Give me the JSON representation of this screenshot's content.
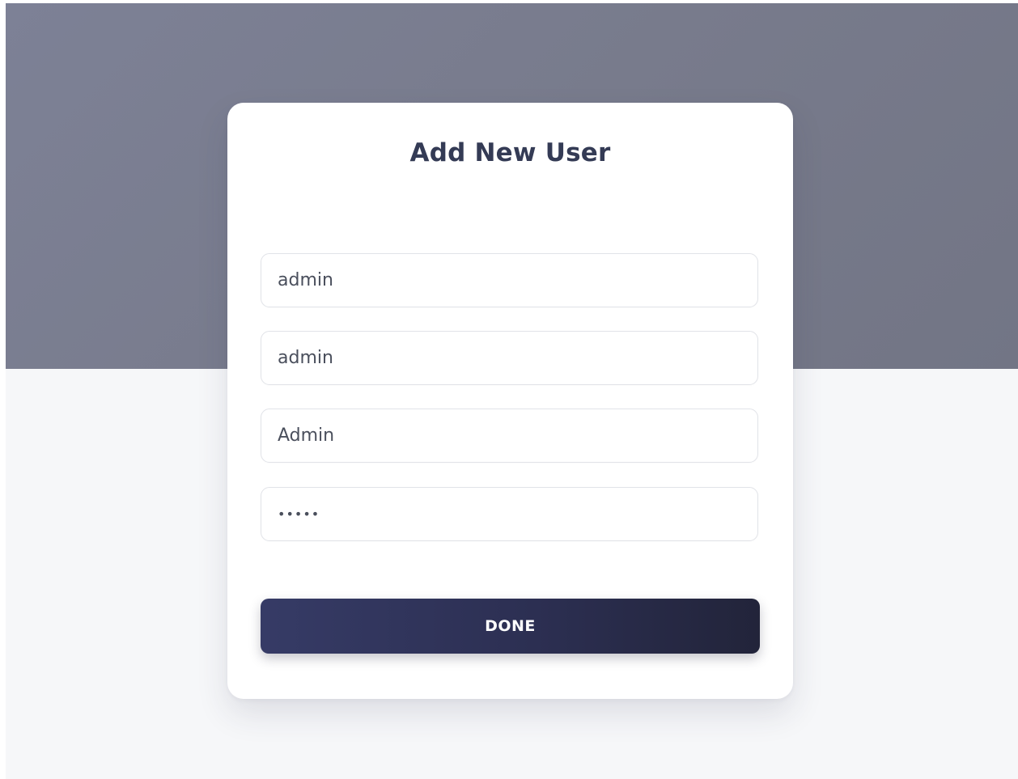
{
  "form": {
    "title": "Add New User",
    "fields": [
      {
        "value": "admin"
      },
      {
        "value": "admin"
      },
      {
        "value": "Admin"
      },
      {
        "value": "•••••"
      }
    ],
    "submit_label": "DONE"
  },
  "colors": {
    "header_background": "#787b8c",
    "page_background": "#f6f7f9",
    "card_background": "#ffffff",
    "title_text": "#343b55",
    "button_gradient_start": "#363b66",
    "button_gradient_end": "#22243a"
  }
}
